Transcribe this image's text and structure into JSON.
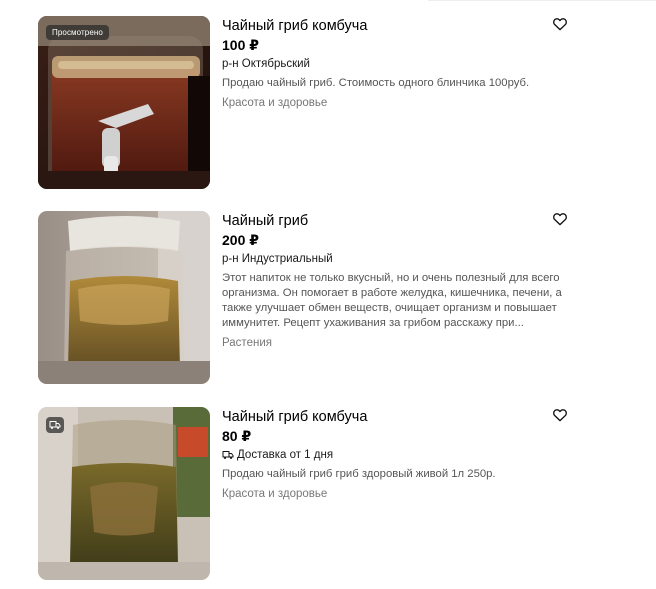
{
  "listings": [
    {
      "title": "Чайный гриб комбуча",
      "price": "100 ₽",
      "location": "р-н Октябрьский",
      "description": "Продаю чайный гриб. Стоимость одного блинчика 100руб.",
      "category": "Красота и здоровье",
      "badge": "Просмотрено",
      "favorite_icon": "heart-outline-icon"
    },
    {
      "title": "Чайный гриб",
      "price": "200 ₽",
      "location": "р-н Индустриальный",
      "description_lines": [
        "Этот напиток не только вкусный, но и очень полезный для всего",
        "организма. Он помогает в работе желудка, кишечника, печени, а",
        "также улучшает обмен веществ, очищает организм и повышает",
        "иммунитет. Рецепт ухаживания за грибом расскажу при..."
      ],
      "category": "Растения",
      "favorite_icon": "heart-outline-icon"
    },
    {
      "title": "Чайный гриб комбуча",
      "price": "80 ₽",
      "delivery": "Доставка от 1 дня",
      "description": "Продаю чайный гриб гриб здоровый живой 1л 250р.",
      "category": "Красота и здоровье",
      "badge_icon": "delivery-truck-icon",
      "favorite_icon": "heart-outline-icon"
    }
  ],
  "colors": {
    "text": "#000000",
    "description": "#555555",
    "category": "#777777",
    "badge_background": "#2a2a2a"
  }
}
